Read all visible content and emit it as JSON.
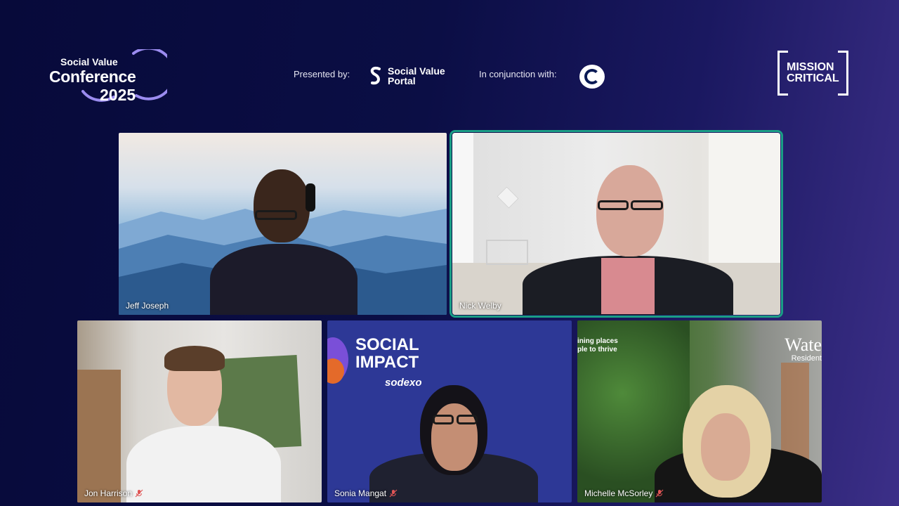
{
  "header": {
    "conference_logo": {
      "line1": "Social Value",
      "line2": "Conference",
      "line3": "2025"
    },
    "presented_by_label": "Presented by:",
    "presenter_logo": {
      "line1": "Social Value",
      "line2": "Portal"
    },
    "conjunction_label": "In conjunction with:",
    "partner_logo_icon": "circular-emblem-icon",
    "mission_logo": {
      "line1": "MISSION",
      "line2": "CRITICAL"
    }
  },
  "participants": [
    {
      "name": "Jeff Joseph",
      "muted": false,
      "active_speaker": false
    },
    {
      "name": "Nick Welby",
      "muted": false,
      "active_speaker": true
    },
    {
      "name": "Jon Harrison",
      "muted": true,
      "active_speaker": false
    },
    {
      "name": "Sonia Mangat",
      "muted": true,
      "active_speaker": false
    },
    {
      "name": "Michelle McSorley",
      "muted": true,
      "active_speaker": false
    }
  ],
  "backgrounds": {
    "sonia": {
      "title_line1": "SOCIAL",
      "title_line2": "IMPACT",
      "brand": "sodexo"
    },
    "michelle": {
      "wall_line1": "ining places",
      "wall_line2": "ple to thrive",
      "sign": "Wate",
      "sign_sub": "Resident"
    }
  },
  "colors": {
    "active_outline": "#1a9e86",
    "mute_icon": "#e05555",
    "background_start": "#070a3a",
    "background_end": "#3c2f88"
  }
}
